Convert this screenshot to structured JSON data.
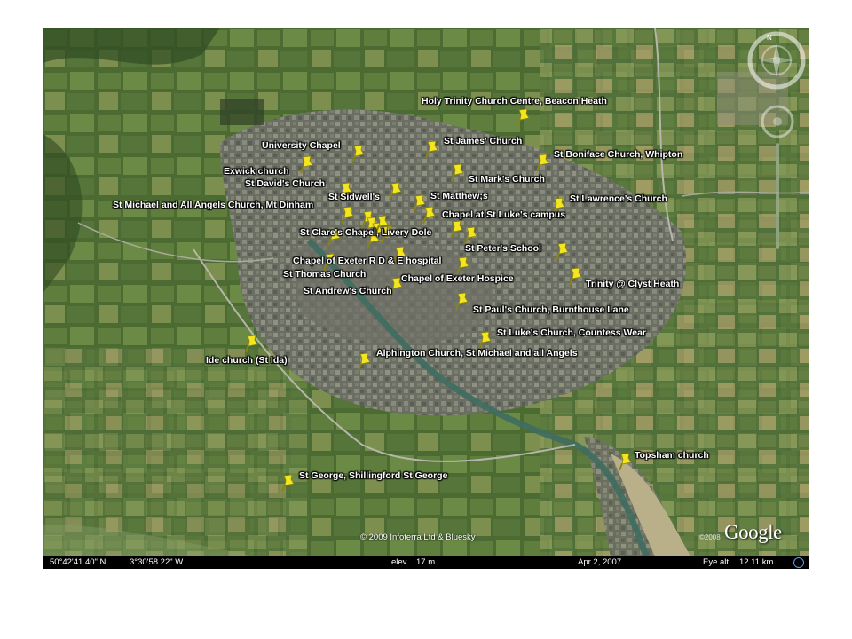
{
  "map": {
    "places": [
      {
        "id": "holy-trinity",
        "label": "Holy Trinity Church Centre, Beacon Heath"
      },
      {
        "id": "university-chapel",
        "label": "University Chapel"
      },
      {
        "id": "st-james",
        "label": "St James' Church"
      },
      {
        "id": "st-boniface",
        "label": "St Boniface Church, Whipton"
      },
      {
        "id": "exwick",
        "label": "Exwick church"
      },
      {
        "id": "st-marks",
        "label": "St Mark's Church"
      },
      {
        "id": "st-davids",
        "label": "St David's Church"
      },
      {
        "id": "st-sidwells",
        "label": "St Sidwell's"
      },
      {
        "id": "st-matthews",
        "label": "St Matthew;s"
      },
      {
        "id": "st-lawrence",
        "label": "St Lawrence's Church"
      },
      {
        "id": "st-michael",
        "label": "St Michael and All Angels Church, Mt Dinham"
      },
      {
        "id": "chapel-st-lukes",
        "label": "Chapel at St Luke's campus"
      },
      {
        "id": "st-clares",
        "label": "St Clare's Chapel, Livery Dole"
      },
      {
        "id": "st-peters",
        "label": "St Peter's School"
      },
      {
        "id": "chapel-rde",
        "label": "Chapel of Exeter R D & E hospital"
      },
      {
        "id": "st-thomas",
        "label": "St Thomas Church"
      },
      {
        "id": "chapel-hospice",
        "label": "Chapel of Exeter Hospice"
      },
      {
        "id": "trinity-clyst",
        "label": "Trinity @ Clyst Heath"
      },
      {
        "id": "st-andrews",
        "label": "St Andrew's Church"
      },
      {
        "id": "st-pauls",
        "label": "St Paul's Church, Burnthouse Lane"
      },
      {
        "id": "st-lukes-cw",
        "label": "St Luke's Church, Countess Wear"
      },
      {
        "id": "ide",
        "label": "Ide church (St Ida)"
      },
      {
        "id": "alphington",
        "label": "Alphington Church, St Michael and all Angels"
      },
      {
        "id": "topsham",
        "label": "Topsham church"
      },
      {
        "id": "st-george",
        "label": "St George, Shillingford St George"
      }
    ],
    "copyright": "© 2009 Infoterra Ltd & Bluesky",
    "imagery_year": "©2008",
    "logo": "Google",
    "compass_north": "N"
  },
  "status": {
    "latitude": "50°42'41.40\" N",
    "longitude": "3°30'58.22\" W",
    "elevation_label": "elev",
    "elevation": "17 m",
    "imagery_date": "Apr 2, 2007",
    "eye_alt_label": "Eye alt",
    "eye_alt": "12.11 km"
  },
  "colors": {
    "pin": "#f3e51e",
    "pin_shadow": "#8a8412",
    "label_text": "#ffffff",
    "statusbar_bg": "#000000"
  }
}
